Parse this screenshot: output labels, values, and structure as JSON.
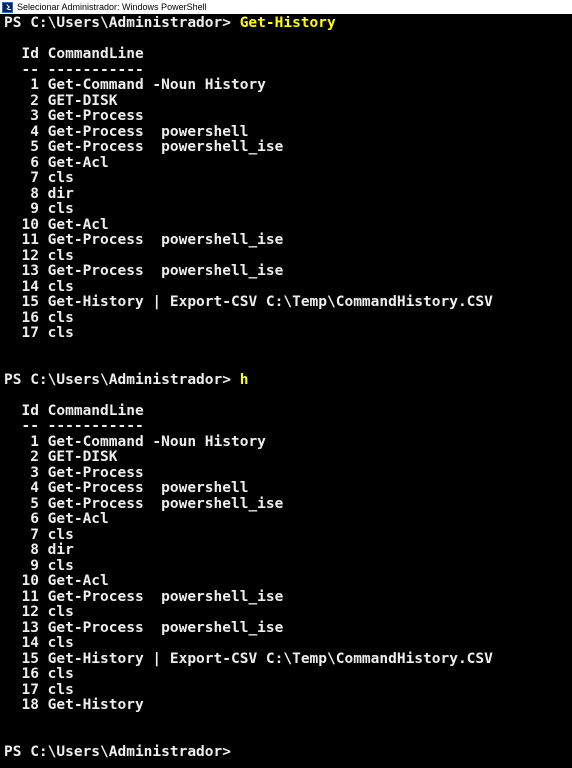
{
  "window": {
    "title": "Selecionar Administrador: Windows PowerShell",
    "icon": "powershell-icon"
  },
  "colors": {
    "background": "#000000",
    "text": "#eeedf0",
    "command": "#ffff00"
  },
  "blocks": [
    {
      "prompt": "PS C:\\Users\\Administrador> ",
      "command": "Get-History",
      "header_id": "  Id",
      "header_cmd": "CommandLine",
      "separator_id": "  --",
      "separator_cmd": "-----------",
      "rows": [
        {
          "id": "1",
          "cmd": "Get-Command -Noun History"
        },
        {
          "id": "2",
          "cmd": "GET-DISK"
        },
        {
          "id": "3",
          "cmd": "Get-Process"
        },
        {
          "id": "4",
          "cmd": "Get-Process  powershell"
        },
        {
          "id": "5",
          "cmd": "Get-Process  powershell_ise"
        },
        {
          "id": "6",
          "cmd": "Get-Acl"
        },
        {
          "id": "7",
          "cmd": "cls"
        },
        {
          "id": "8",
          "cmd": "dir"
        },
        {
          "id": "9",
          "cmd": "cls"
        },
        {
          "id": "10",
          "cmd": "Get-Acl"
        },
        {
          "id": "11",
          "cmd": "Get-Process  powershell_ise"
        },
        {
          "id": "12",
          "cmd": "cls"
        },
        {
          "id": "13",
          "cmd": "Get-Process  powershell_ise"
        },
        {
          "id": "14",
          "cmd": "cls"
        },
        {
          "id": "15",
          "cmd": "Get-History | Export-CSV C:\\Temp\\CommandHistory.CSV"
        },
        {
          "id": "16",
          "cmd": "cls"
        },
        {
          "id": "17",
          "cmd": "cls"
        }
      ]
    },
    {
      "prompt": "PS C:\\Users\\Administrador> ",
      "command": "h",
      "header_id": "  Id",
      "header_cmd": "CommandLine",
      "separator_id": "  --",
      "separator_cmd": "-----------",
      "rows": [
        {
          "id": "1",
          "cmd": "Get-Command -Noun History"
        },
        {
          "id": "2",
          "cmd": "GET-DISK"
        },
        {
          "id": "3",
          "cmd": "Get-Process"
        },
        {
          "id": "4",
          "cmd": "Get-Process  powershell"
        },
        {
          "id": "5",
          "cmd": "Get-Process  powershell_ise"
        },
        {
          "id": "6",
          "cmd": "Get-Acl"
        },
        {
          "id": "7",
          "cmd": "cls"
        },
        {
          "id": "8",
          "cmd": "dir"
        },
        {
          "id": "9",
          "cmd": "cls"
        },
        {
          "id": "10",
          "cmd": "Get-Acl"
        },
        {
          "id": "11",
          "cmd": "Get-Process  powershell_ise"
        },
        {
          "id": "12",
          "cmd": "cls"
        },
        {
          "id": "13",
          "cmd": "Get-Process  powershell_ise"
        },
        {
          "id": "14",
          "cmd": "cls"
        },
        {
          "id": "15",
          "cmd": "Get-History | Export-CSV C:\\Temp\\CommandHistory.CSV"
        },
        {
          "id": "16",
          "cmd": "cls"
        },
        {
          "id": "17",
          "cmd": "cls"
        },
        {
          "id": "18",
          "cmd": "Get-History"
        }
      ]
    }
  ],
  "final_prompt": "PS C:\\Users\\Administrador>"
}
